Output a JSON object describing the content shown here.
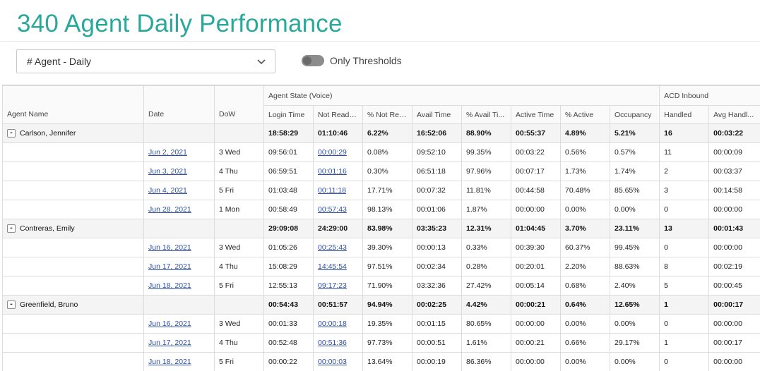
{
  "page": {
    "title": "340 Agent Daily Performance"
  },
  "controls": {
    "dropdown_value": "# Agent - Daily",
    "toggle_label": "Only Thresholds",
    "toggle_on": false
  },
  "table": {
    "groups": {
      "agent_state": "Agent State (Voice)",
      "acd_inbound": "ACD Inbound"
    },
    "columns": {
      "agent_name": "Agent Name",
      "date": "Date",
      "dow": "DoW",
      "login_time": "Login Time",
      "not_ready": "Not Ready...",
      "pct_not_ready": "% Not Rea...",
      "avail_time": "Avail Time",
      "pct_avail": "% Avail Ti...",
      "active_time": "Active Time",
      "pct_active": "% Active",
      "occupancy": "Occupancy",
      "handled": "Handled",
      "avg_handle": "Avg Handl..."
    },
    "agents": [
      {
        "name": "Carlson, Jennifer",
        "summary": [
          "18:58:29",
          "01:10:46",
          "6.22%",
          "16:52:06",
          "88.90%",
          "00:55:37",
          "4.89%",
          "5.21%",
          "16",
          "00:03:22"
        ],
        "rows": [
          {
            "date": "Jun 2, 2021",
            "dow": "3 Wed",
            "not_ready": "00:00:29",
            "vals": [
              "09:56:01",
              "0.08%",
              "09:52:10",
              "99.35%",
              "00:03:22",
              "0.56%",
              "0.57%",
              "11",
              "00:00:09"
            ]
          },
          {
            "date": "Jun 3, 2021",
            "dow": "4 Thu",
            "not_ready": "00:01:16",
            "vals": [
              "06:59:51",
              "0.30%",
              "06:51:18",
              "97.96%",
              "00:07:17",
              "1.73%",
              "1.74%",
              "2",
              "00:03:37"
            ]
          },
          {
            "date": "Jun 4, 2021",
            "dow": "5 Fri",
            "not_ready": "00:11:18",
            "vals": [
              "01:03:48",
              "17.71%",
              "00:07:32",
              "11.81%",
              "00:44:58",
              "70.48%",
              "85.65%",
              "3",
              "00:14:58"
            ]
          },
          {
            "date": "Jun 28, 2021",
            "dow": "1 Mon",
            "not_ready": "00:57:43",
            "vals": [
              "00:58:49",
              "98.13%",
              "00:01:06",
              "1.87%",
              "00:00:00",
              "0.00%",
              "0.00%",
              "0",
              "00:00:00"
            ]
          }
        ]
      },
      {
        "name": "Contreras, Emily",
        "summary": [
          "29:09:08",
          "24:29:00",
          "83.98%",
          "03:35:23",
          "12.31%",
          "01:04:45",
          "3.70%",
          "23.11%",
          "13",
          "00:01:43"
        ],
        "rows": [
          {
            "date": "Jun 16, 2021",
            "dow": "3 Wed",
            "not_ready": "00:25:43",
            "vals": [
              "01:05:26",
              "39.30%",
              "00:00:13",
              "0.33%",
              "00:39:30",
              "60.37%",
              "99.45%",
              "0",
              "00:00:00"
            ]
          },
          {
            "date": "Jun 17, 2021",
            "dow": "4 Thu",
            "not_ready": "14:45:54",
            "vals": [
              "15:08:29",
              "97.51%",
              "00:02:34",
              "0.28%",
              "00:20:01",
              "2.20%",
              "88.63%",
              "8",
              "00:02:19"
            ]
          },
          {
            "date": "Jun 18, 2021",
            "dow": "5 Fri",
            "not_ready": "09:17:23",
            "vals": [
              "12:55:13",
              "71.90%",
              "03:32:36",
              "27.42%",
              "00:05:14",
              "0.68%",
              "2.40%",
              "5",
              "00:00:45"
            ]
          }
        ]
      },
      {
        "name": "Greenfield, Bruno",
        "summary": [
          "00:54:43",
          "00:51:57",
          "94.94%",
          "00:02:25",
          "4.42%",
          "00:00:21",
          "0.64%",
          "12.65%",
          "1",
          "00:00:17"
        ],
        "rows": [
          {
            "date": "Jun 16, 2021",
            "dow": "3 Wed",
            "not_ready": "00:00:18",
            "vals": [
              "00:01:33",
              "19.35%",
              "00:01:15",
              "80.65%",
              "00:00:00",
              "0.00%",
              "0.00%",
              "0",
              "00:00:00"
            ]
          },
          {
            "date": "Jun 17, 2021",
            "dow": "4 Thu",
            "not_ready": "00:51:36",
            "vals": [
              "00:52:48",
              "97.73%",
              "00:00:51",
              "1.61%",
              "00:00:21",
              "0.66%",
              "29.17%",
              "1",
              "00:00:17"
            ]
          },
          {
            "date": "Jun 18, 2021",
            "dow": "5 Fri",
            "not_ready": "00:00:03",
            "vals": [
              "00:00:22",
              "13.64%",
              "00:00:19",
              "86.36%",
              "00:00:00",
              "0.00%",
              "0.00%",
              "0",
              "00:00:00"
            ]
          }
        ]
      }
    ]
  }
}
